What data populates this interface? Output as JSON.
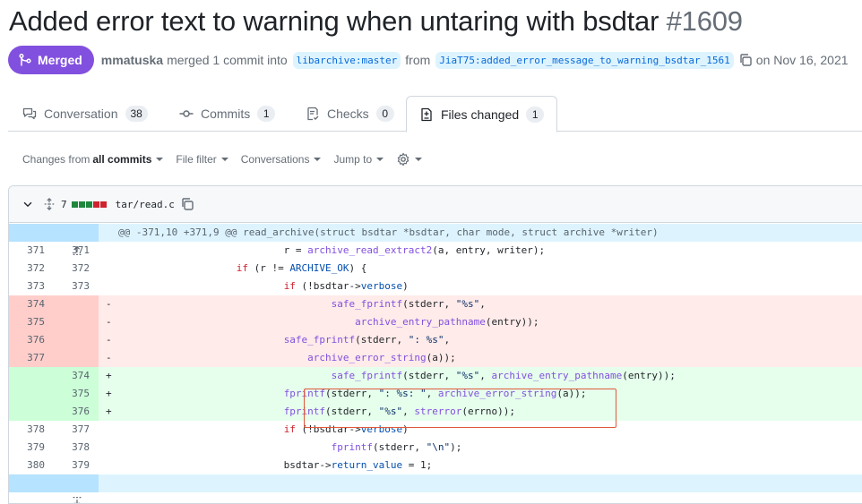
{
  "pr": {
    "title": "Added error text to warning when untaring with bsdtar",
    "number": "#1609",
    "status": "Merged",
    "author": "mmatuska",
    "merged_text": "merged 1 commit into",
    "base_ref": "libarchive:master",
    "from_text": "from",
    "head_ref": "JiaT75:added_error_message_to_warning_bsdtar_1561",
    "date_text": "on Nov 16, 2021"
  },
  "tabs": [
    {
      "label": "Conversation",
      "count": "38",
      "icon": "comment-discussion-icon"
    },
    {
      "label": "Commits",
      "count": "1",
      "icon": "git-commit-icon"
    },
    {
      "label": "Checks",
      "count": "0",
      "icon": "checklist-icon"
    },
    {
      "label": "Files changed",
      "count": "1",
      "icon": "file-diff-icon",
      "active": true
    }
  ],
  "toolbar": {
    "changes_from_prefix": "Changes from",
    "changes_from_value": "all commits",
    "file_filter": "File filter",
    "conversations": "Conversations",
    "jump_to": "Jump to"
  },
  "file": {
    "changes_count": "7",
    "name": "tar/read.c",
    "diffstat_colors": [
      "#1f883d",
      "#1f883d",
      "#1f883d",
      "#cf222e",
      "#cf222e",
      "#cf222e",
      "#cf222e"
    ],
    "hunk_header": "@@ -371,10 +371,9 @@ read_archive(struct bsdtar *bsdtar, char mode, struct archive *writer)"
  },
  "colors": {
    "merged": "#8250df",
    "add": "#1f883d",
    "del": "#cf222e",
    "highlight": "#e0593d"
  }
}
